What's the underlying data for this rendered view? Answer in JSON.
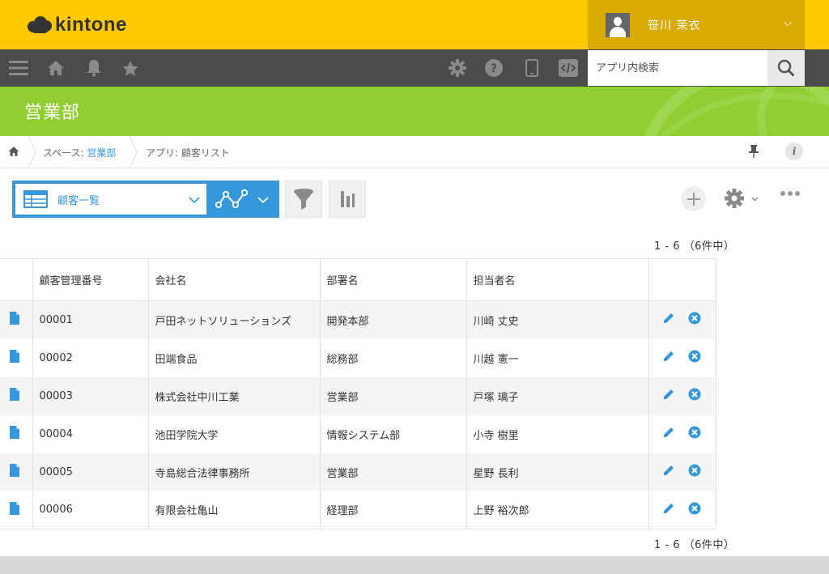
{
  "app": {
    "logo_text": "kintone"
  },
  "user": {
    "name": "笹川 茉衣"
  },
  "nav": {
    "icons": [
      "menu-icon",
      "home-icon",
      "bell-icon",
      "star-icon",
      "gear-icon",
      "help-icon",
      "mobile-icon",
      "code-icon"
    ],
    "search_placeholder": "アプリ内検索"
  },
  "banner": {
    "title": "営業部"
  },
  "breadcrumb": {
    "space_prefix": "スペース: ",
    "space_name": "営業部",
    "app_label": "アプリ: 顧客リスト"
  },
  "toolbar": {
    "view_name": "顧客一覧"
  },
  "pager": {
    "top": "1 - 6 （6件中）",
    "bottom": "1 - 6 （6件中）"
  },
  "table": {
    "headers": [
      "顧客管理番号",
      "会社名",
      "部署名",
      "担当者名"
    ],
    "rows": [
      [
        "00001",
        "戸田ネットソリューションズ",
        "開発本部",
        "川崎 丈史"
      ],
      [
        "00002",
        "田端食品",
        "総務部",
        "川越 憲一"
      ],
      [
        "00003",
        "株式会社中川工業",
        "営業部",
        "戸塚 璃子"
      ],
      [
        "00004",
        "池田学院大学",
        "情報システム部",
        "小寺 樹里"
      ],
      [
        "00005",
        "寺島総合法律事務所",
        "営業部",
        "星野 長利"
      ],
      [
        "00006",
        "有限会社亀山",
        "経理部",
        "上野 裕次郎"
      ]
    ]
  },
  "colors": {
    "header_yellow": "#ffc800",
    "nav_dark": "#4b4b4b",
    "banner_green": "#8fcf32",
    "accent_blue": "#3498db"
  }
}
